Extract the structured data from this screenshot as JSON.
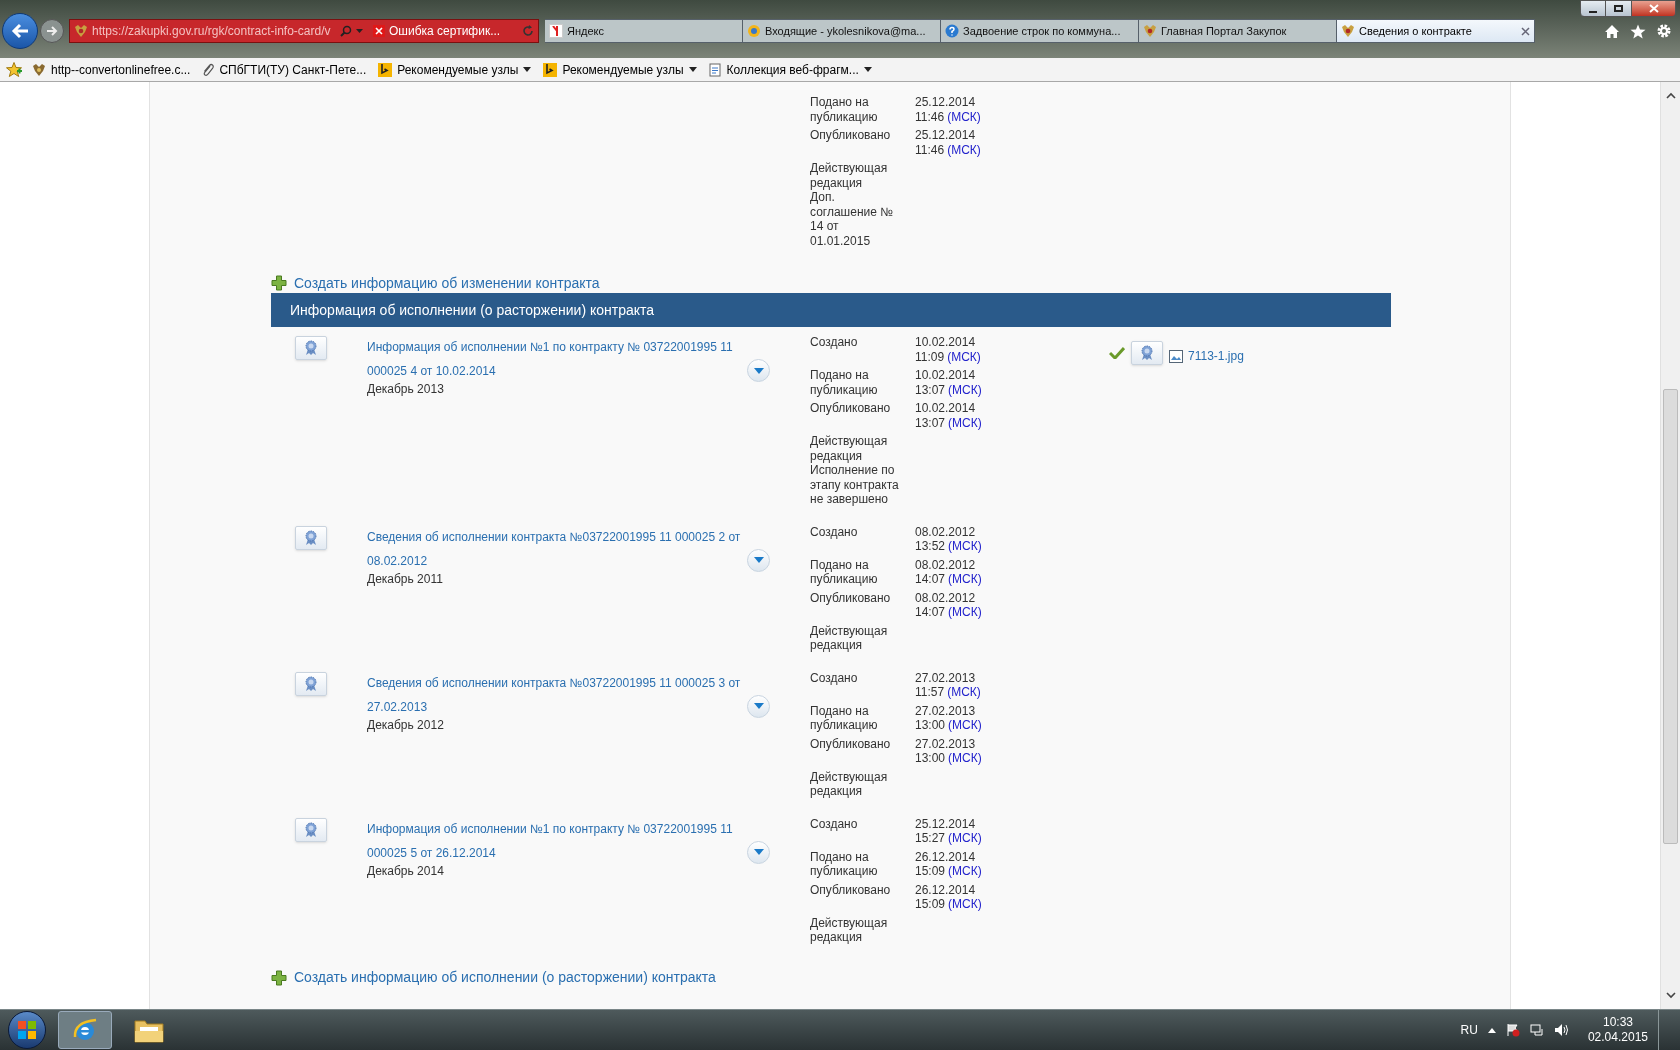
{
  "browser": {
    "address": "https://zakupki.gov.ru/rgk/contract-info-card/v",
    "certificate_error": "Ошибка сертифик...",
    "tabs": [
      {
        "title": "Яндекс",
        "selected": false,
        "kind": "yandex"
      },
      {
        "title": "Входящие - ykolesnikova@ma...",
        "selected": false,
        "kind": "mail"
      },
      {
        "title": "Задвоение строк по коммуна...",
        "selected": false,
        "kind": "help"
      },
      {
        "title": "Главная Портал Закупок",
        "selected": false,
        "kind": "emblem"
      },
      {
        "title": "Сведения о контракте",
        "selected": true,
        "kind": "emblem"
      }
    ],
    "favorites": [
      {
        "title": "http--convertonlinefree.c...",
        "kind": "site",
        "menu": false
      },
      {
        "title": "СПбГТИ(ТУ) Санкт-Пете...",
        "kind": "clip",
        "menu": false
      },
      {
        "title": "Рекомендуемые узлы",
        "kind": "bing",
        "menu": true
      },
      {
        "title": "Рекомендуемые узлы",
        "kind": "bing",
        "menu": true
      },
      {
        "title": "Коллекция веб-фрагм...",
        "kind": "page",
        "menu": true
      }
    ]
  },
  "previous_entry": {
    "details": [
      {
        "label": "Подано на публикацию",
        "date": "25.12.2014",
        "time": "11:46",
        "zone": "(МСК)"
      },
      {
        "label": "Опубликовано",
        "date": "25.12.2014",
        "time": "11:46",
        "zone": "(МСК)"
      }
    ],
    "status_label": "Действующая редакция",
    "status_note": "Доп. соглашение № 14 от 01.01.2015"
  },
  "create_change_link": "Создать информацию об изменении контракта",
  "section_title": "Информация об исполнении (о расторжении) контракта",
  "entries": [
    {
      "title": "Информация об исполнении №1 по контракту № 03722001995 11 000025 4 от 10.02.2014",
      "period": "Декабрь 2013",
      "details": [
        {
          "label": "Создано",
          "date": "10.02.2014",
          "time": "11:09",
          "zone": "(МСК)"
        },
        {
          "label": "Подано на публикацию",
          "date": "10.02.2014",
          "time": "13:07",
          "zone": "(МСК)"
        },
        {
          "label": "Опубликовано",
          "date": "10.02.2014",
          "time": "13:07",
          "zone": "(МСК)"
        }
      ],
      "status_label": "Действующая редакция",
      "status_note": "Исполнение по этапу контракта не завершено",
      "signed": true,
      "attachment": "7113-1.jpg"
    },
    {
      "title": "Сведения об исполнении контракта №03722001995 11 000025 2 от 08.02.2012",
      "period": "Декабрь 2011",
      "details": [
        {
          "label": "Создано",
          "date": "08.02.2012",
          "time": "13:52",
          "zone": "(МСК)"
        },
        {
          "label": "Подано на публикацию",
          "date": "08.02.2012",
          "time": "14:07",
          "zone": "(МСК)"
        },
        {
          "label": "Опубликовано",
          "date": "08.02.2012",
          "time": "14:07",
          "zone": "(МСК)"
        }
      ],
      "status_label": "Действующая редакция",
      "signed": false
    },
    {
      "title": "Сведения об исполнении контракта №03722001995 11 000025 3 от 27.02.2013",
      "period": "Декабрь 2012",
      "details": [
        {
          "label": "Создано",
          "date": "27.02.2013",
          "time": "11:57",
          "zone": "(МСК)"
        },
        {
          "label": "Подано на публикацию",
          "date": "27.02.2013",
          "time": "13:00",
          "zone": "(МСК)"
        },
        {
          "label": "Опубликовано",
          "date": "27.02.2013",
          "time": "13:00",
          "zone": "(МСК)"
        }
      ],
      "status_label": "Действующая редакция",
      "signed": false
    },
    {
      "title": "Информация об исполнении №1 по контракту № 03722001995 11 000025 5 от 26.12.2014",
      "period": "Декабрь 2014",
      "details": [
        {
          "label": "Создано",
          "date": "25.12.2014",
          "time": "15:27",
          "zone": "(МСК)"
        },
        {
          "label": "Подано на публикацию",
          "date": "26.12.2014",
          "time": "15:09",
          "zone": "(МСК)"
        },
        {
          "label": "Опубликовано",
          "date": "26.12.2014",
          "time": "15:09",
          "zone": "(МСК)"
        }
      ],
      "status_label": "Действующая редакция",
      "signed": false
    }
  ],
  "create_execution_link": "Создать информацию об исполнении (о расторжении) контракта",
  "taskbar": {
    "language": "RU",
    "time": "10:33",
    "date": "02.04.2015"
  }
}
